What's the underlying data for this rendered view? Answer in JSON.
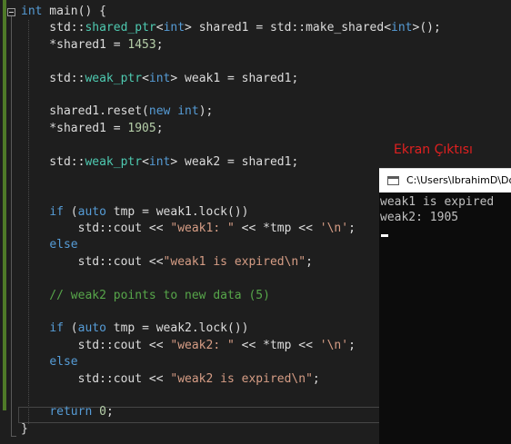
{
  "editor": {
    "lines": [
      [
        {
          "t": "int",
          "c": "kw"
        },
        {
          "t": " main() {",
          "c": "plain"
        }
      ],
      [
        {
          "t": "    std::",
          "c": "plain"
        },
        {
          "t": "shared_ptr",
          "c": "type"
        },
        {
          "t": "<",
          "c": "plain"
        },
        {
          "t": "int",
          "c": "kw"
        },
        {
          "t": "> shared1 = std::make_shared<",
          "c": "plain"
        },
        {
          "t": "int",
          "c": "kw"
        },
        {
          "t": ">();",
          "c": "plain"
        }
      ],
      [
        {
          "t": "    *shared1 = ",
          "c": "plain"
        },
        {
          "t": "1453",
          "c": "num"
        },
        {
          "t": ";",
          "c": "plain"
        }
      ],
      [],
      [
        {
          "t": "    std::",
          "c": "plain"
        },
        {
          "t": "weak_ptr",
          "c": "type"
        },
        {
          "t": "<",
          "c": "plain"
        },
        {
          "t": "int",
          "c": "kw"
        },
        {
          "t": "> weak1 = shared1;",
          "c": "plain"
        }
      ],
      [],
      [
        {
          "t": "    shared1.reset(",
          "c": "plain"
        },
        {
          "t": "new",
          "c": "kw"
        },
        {
          "t": " ",
          "c": "plain"
        },
        {
          "t": "int",
          "c": "kw"
        },
        {
          "t": ");",
          "c": "plain"
        }
      ],
      [
        {
          "t": "    *shared1 = ",
          "c": "plain"
        },
        {
          "t": "1905",
          "c": "num"
        },
        {
          "t": ";",
          "c": "plain"
        }
      ],
      [],
      [
        {
          "t": "    std::",
          "c": "plain"
        },
        {
          "t": "weak_ptr",
          "c": "type"
        },
        {
          "t": "<",
          "c": "plain"
        },
        {
          "t": "int",
          "c": "kw"
        },
        {
          "t": "> weak2 = shared1;",
          "c": "plain"
        }
      ],
      [],
      [],
      [
        {
          "t": "    ",
          "c": "plain"
        },
        {
          "t": "if",
          "c": "kw"
        },
        {
          "t": " (",
          "c": "plain"
        },
        {
          "t": "auto",
          "c": "kw"
        },
        {
          "t": " tmp = weak1.lock())",
          "c": "plain"
        }
      ],
      [
        {
          "t": "        std::cout << ",
          "c": "plain"
        },
        {
          "t": "\"weak1: \"",
          "c": "str"
        },
        {
          "t": " << *tmp << ",
          "c": "plain"
        },
        {
          "t": "'\\n'",
          "c": "str"
        },
        {
          "t": ";",
          "c": "plain"
        }
      ],
      [
        {
          "t": "    ",
          "c": "plain"
        },
        {
          "t": "else",
          "c": "kw"
        }
      ],
      [
        {
          "t": "        std::cout <<",
          "c": "plain"
        },
        {
          "t": "\"weak1 is expired\\n\"",
          "c": "str"
        },
        {
          "t": ";",
          "c": "plain"
        }
      ],
      [],
      [
        {
          "t": "    // weak2 points to new data (5)",
          "c": "com"
        }
      ],
      [],
      [
        {
          "t": "    ",
          "c": "plain"
        },
        {
          "t": "if",
          "c": "kw"
        },
        {
          "t": " (",
          "c": "plain"
        },
        {
          "t": "auto",
          "c": "kw"
        },
        {
          "t": " tmp = weak2.lock())",
          "c": "plain"
        }
      ],
      [
        {
          "t": "        std::cout << ",
          "c": "plain"
        },
        {
          "t": "\"weak2: \"",
          "c": "str"
        },
        {
          "t": " << *tmp << ",
          "c": "plain"
        },
        {
          "t": "'\\n'",
          "c": "str"
        },
        {
          "t": ";",
          "c": "plain"
        }
      ],
      [
        {
          "t": "    ",
          "c": "plain"
        },
        {
          "t": "else",
          "c": "kw"
        }
      ],
      [
        {
          "t": "        std::cout << ",
          "c": "plain"
        },
        {
          "t": "\"weak2 is expired\\n\"",
          "c": "str"
        },
        {
          "t": ";",
          "c": "plain"
        }
      ],
      [],
      [
        {
          "t": "    ",
          "c": "plain"
        },
        {
          "t": "return",
          "c": "kw"
        },
        {
          "t": " ",
          "c": "plain"
        },
        {
          "t": "0",
          "c": "num"
        },
        {
          "t": ";",
          "c": "plain"
        }
      ],
      [
        {
          "t": "}",
          "c": "plain"
        }
      ]
    ]
  },
  "caption": "Ekran Çıktısı",
  "console": {
    "title": "C:\\Users\\IbrahimD\\Do",
    "output": [
      "weak1 is expired",
      "weak2: 1905"
    ]
  },
  "colors": {
    "editor_background": "#1e1e1e",
    "keyword": "#569cd6",
    "type": "#4ec9b0",
    "string": "#d69d85",
    "number": "#b5cea8",
    "comment": "#57a64a",
    "caption": "#e02020"
  },
  "icons": {
    "collapse": "collapse-minus-icon",
    "console": "console-window-icon"
  }
}
